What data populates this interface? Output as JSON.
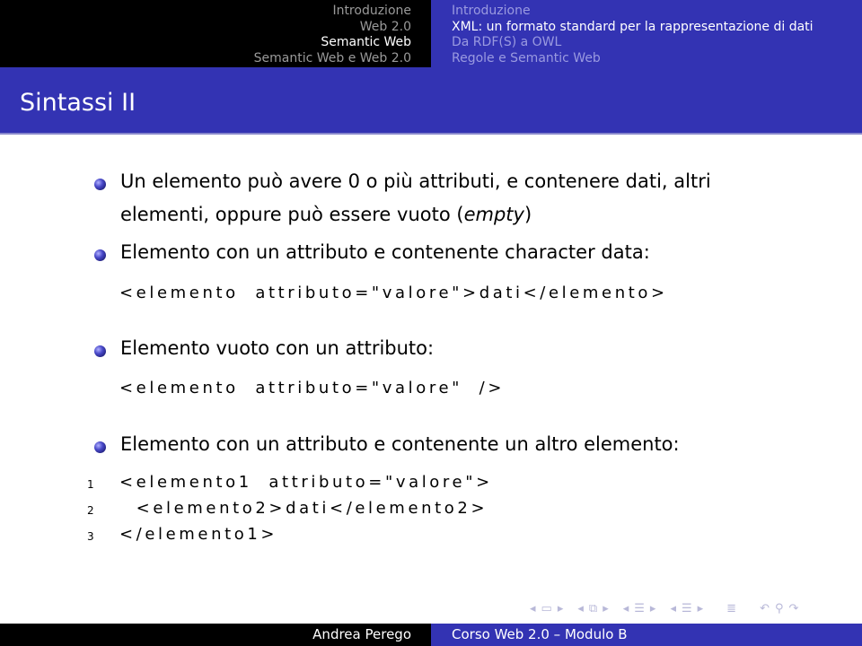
{
  "header": {
    "sections": [
      {
        "label": "Introduzione",
        "active": false
      },
      {
        "label": "Web 2.0",
        "active": false
      },
      {
        "label": "Semantic Web",
        "active": true
      },
      {
        "label": "Semantic Web e Web 2.0",
        "active": false
      }
    ],
    "subsections": [
      {
        "label": "Introduzione",
        "active": false
      },
      {
        "label": "XML: un formato standard per la rappresentazione di dati",
        "active": true
      },
      {
        "label": "Da RDF(S) a OWL",
        "active": false
      },
      {
        "label": "Regole e Semantic Web",
        "active": false
      }
    ]
  },
  "slide": {
    "title": "Sintassi II",
    "bullets": [
      {
        "line1": "Un elemento può avere 0 o più attributi, e contenere dati, altri",
        "line2_prefix": "elementi, oppure può essere vuoto (",
        "line2_em": "empty",
        "line2_suffix": ")"
      },
      {
        "text": "Elemento con un attributo e contenente character data:"
      },
      {
        "text": "Elemento vuoto con un attributo:"
      },
      {
        "text": "Elemento con un attributo e contenente un altro elemento:"
      }
    ],
    "code1": "<elemento  attributo=\"valore\">dati</elemento>",
    "code2": "<elemento  attributo=\"valore\"  />",
    "listing": [
      {
        "n": "1",
        "code": "<elemento1  attributo=\"valore\">"
      },
      {
        "n": "2",
        "code": "  <elemento2>dati</elemento2>"
      },
      {
        "n": "3",
        "code": "</elemento1>"
      }
    ]
  },
  "navigation": {
    "icons": [
      "prev-frame",
      "frame",
      "next-frame",
      "prev-subsection",
      "subsection",
      "next-subsection",
      "prev-section",
      "section",
      "next-section",
      "prev-slide",
      "slide",
      "next-slide",
      "align",
      "undo",
      "search",
      "redo"
    ]
  },
  "footer": {
    "author": "Andrea Perego",
    "course": "Corso Web 2.0 – Modulo B"
  }
}
